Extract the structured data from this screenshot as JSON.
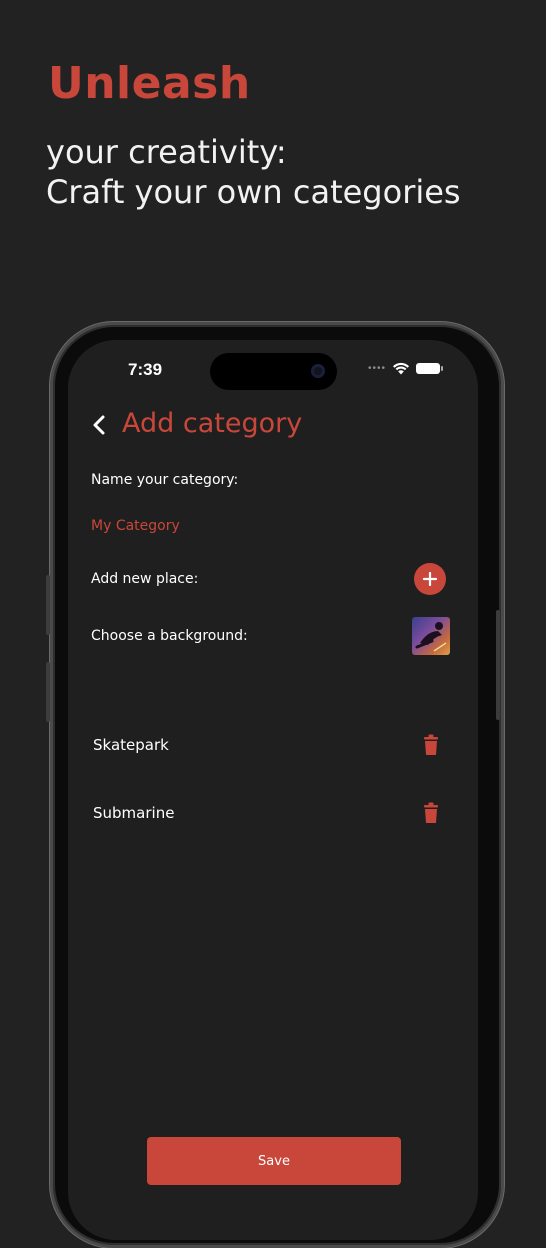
{
  "promo": {
    "headline": "Unleash",
    "line1": "your creativity:",
    "line2": "Craft your own categories"
  },
  "status_bar": {
    "time": "7:39",
    "icons": [
      "signal-dots-icon",
      "wifi-icon",
      "battery-icon"
    ]
  },
  "nav": {
    "back_icon": "chevron-left-icon",
    "title": "Add category"
  },
  "form": {
    "name_label": "Name your category:",
    "name_value": "My Category",
    "add_place_label": "Add new place:",
    "add_place_icon": "plus-icon",
    "background_label": "Choose a background:",
    "background_thumb": "background-thumbnail"
  },
  "places": [
    {
      "name": "Skatepark",
      "delete_icon": "trash-icon"
    },
    {
      "name": "Submarine",
      "delete_icon": "trash-icon"
    }
  ],
  "actions": {
    "save_label": "Save"
  },
  "colors": {
    "accent": "#c9473a",
    "background": "#222222",
    "screen": "#1f1f1f",
    "text": "#ffffff"
  }
}
